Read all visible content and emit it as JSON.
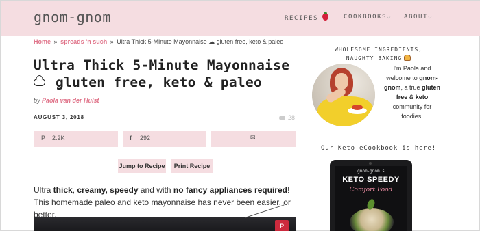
{
  "header": {
    "logo": "gnom-gnom",
    "nav": {
      "recipes": "RECIPES",
      "cookbooks": "COOKBOOKS",
      "about": "ABOUT",
      "chevron": "⌵"
    }
  },
  "breadcrumb": {
    "home": "Home",
    "separator": "»",
    "category": "spreads 'n such",
    "current": "Ultra Thick 5-Minute Mayonnaise ☁ gluten free, keto & paleo"
  },
  "post": {
    "title_line1": "Ultra Thick 5-Minute Mayonnaise",
    "title_line2": "gluten free, keto & paleo",
    "by": "by",
    "author": "Paola van der Hulst",
    "date": "AUGUST 3, 2018",
    "comment_count": "28"
  },
  "share": {
    "pinterest_icon": "P",
    "pinterest_count": "2.2K",
    "facebook_icon": "f",
    "facebook_count": "292",
    "email_icon": "✉"
  },
  "buttons": {
    "jump": "Jump to Recipe",
    "print": "Print Recipe"
  },
  "intro": {
    "p1": "Ultra ",
    "b1": "thick",
    "p2": ", ",
    "b2": "creamy, speedy",
    "p3": " and with ",
    "b3": "no fancy appliances required",
    "p4": "! This homemade paleo and keto mayonnaise has never been easier, or better."
  },
  "hero": {
    "pin_label": "P"
  },
  "sidebar": {
    "tagline_line1": "WHOLESOME INGREDIENTS,",
    "tagline_line2": "NAUGHTY BAKING",
    "intro_1": "I'm Paola and welcome to ",
    "intro_name": "gnom-gnom",
    "intro_2": ", a true ",
    "intro_bold": "gluten free & keto",
    "intro_3": " community for foodies!",
    "book_heading": "Our Keto eCookbook is here!",
    "book_brand": "gnom-gnom's",
    "book_title": "KETO SPEEDY",
    "book_subtitle": "Comfort Food"
  },
  "colors": {
    "header_bg": "#f5dde1",
    "accent_pink": "#e0748a",
    "pinterest_red": "#cc2a3d"
  }
}
